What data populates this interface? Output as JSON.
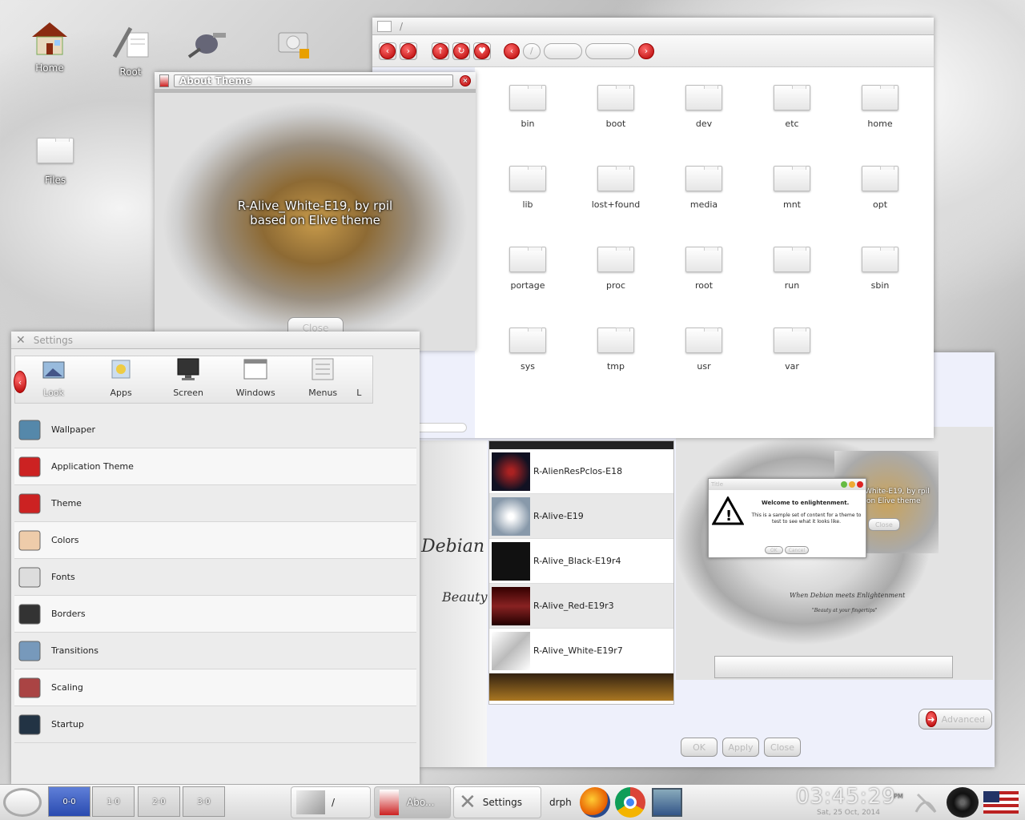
{
  "desktop": {
    "icons": [
      {
        "label": "Home"
      },
      {
        "label": "Root"
      },
      {
        "label": "Files"
      }
    ]
  },
  "file_manager": {
    "title": "/",
    "folders": [
      "bin",
      "boot",
      "dev",
      "etc",
      "home",
      "lib",
      "lost+found",
      "media",
      "mnt",
      "opt",
      "portage",
      "proc",
      "root",
      "run",
      "sbin",
      "sys",
      "tmp",
      "usr",
      "var"
    ]
  },
  "about_theme": {
    "title": "About Theme",
    "line1": "R-Alive_White-E19, by rpil",
    "line2": "based on Elive theme",
    "close_label": "Close"
  },
  "settings": {
    "title": "Settings",
    "categories": [
      "Look",
      "Apps",
      "Screen",
      "Windows",
      "Menus",
      "L"
    ],
    "items": [
      "Wallpaper",
      "Application Theme",
      "Theme",
      "Colors",
      "Fonts",
      "Borders",
      "Transitions",
      "Scaling",
      "Startup"
    ]
  },
  "theme_dialog": {
    "themes": [
      "R-AlienResPclos-E18",
      "R-Alive-E19",
      "R-Alive_Black-E19r4",
      "R-Alive_Red-E19r3",
      "R-Alive_White-E19r7"
    ],
    "art_text1": "Debian",
    "art_text2": "Beauty",
    "preview": {
      "popup_title": "Title",
      "popup_heading": "Welcome to enlightenment.",
      "popup_body": "This is a sample set of content for a theme to test to see what it looks like.",
      "popup_ok": "OK",
      "popup_cancel": "Cancel",
      "about_line1": "White-E19, by rpil",
      "about_line2": "on Elive theme",
      "about_close": "Close",
      "logo_text": "When Debian meets Enlightenment",
      "logo_sub": "\"Beauty at your fingertips\""
    },
    "advanced_label": "Advanced",
    "ok_label": "OK",
    "apply_label": "Apply",
    "close_label": "Close"
  },
  "taskbar": {
    "pager": [
      "0-0",
      "1-0",
      "2-0",
      "3-0"
    ],
    "tasks": [
      {
        "label": "/"
      },
      {
        "label": "Abo..."
      },
      {
        "label": "Settings"
      },
      {
        "label": "drph"
      }
    ],
    "clock_time": "03:45:29",
    "clock_ampm": "PM",
    "clock_date": "Sat, 25 Oct, 2014"
  },
  "colors": {
    "accent_red": "#c00000",
    "window_bg": "#eef0fb"
  }
}
